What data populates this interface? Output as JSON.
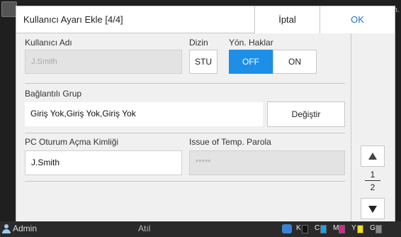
{
  "screen": {
    "corner_text": "n."
  },
  "dialog": {
    "title": "Kullanıcı Ayarı Ekle [4/4]",
    "cancel_label": "İptal",
    "ok_label": "OK"
  },
  "form": {
    "username_label": "Kullanıcı Adı",
    "username_value": "J.Smith",
    "directory_label": "Dizin",
    "directory_button": "STU",
    "admin_rights_label": "Yön. Haklar",
    "admin_off_label": "OFF",
    "admin_on_label": "ON",
    "admin_rights_state": "OFF",
    "group_label": "Bağlantılı Grup",
    "group_value": "Giriş Yok,Giriş Yok,Giriş Yok",
    "change_button": "Değiştir",
    "pc_login_label": "PC Oturum Açma Kimliği",
    "pc_login_value": "J.Smith",
    "temp_password_label": "Issue of Temp. Parola",
    "temp_password_value": "*****"
  },
  "pager": {
    "current_page": "1",
    "total_pages": "2"
  },
  "status_bar": {
    "user": "Admin",
    "mode": "Atıl",
    "ink": [
      {
        "label": "K",
        "color": "#111111"
      },
      {
        "label": "C",
        "color": "#1aa3e8"
      },
      {
        "label": "M",
        "color": "#d4298a"
      },
      {
        "label": "Y",
        "color": "#f2e11c"
      },
      {
        "label": "G",
        "color": "#888888"
      }
    ]
  },
  "colors": {
    "accent": "#1e8fe6",
    "ok_text": "#1d74c9"
  }
}
